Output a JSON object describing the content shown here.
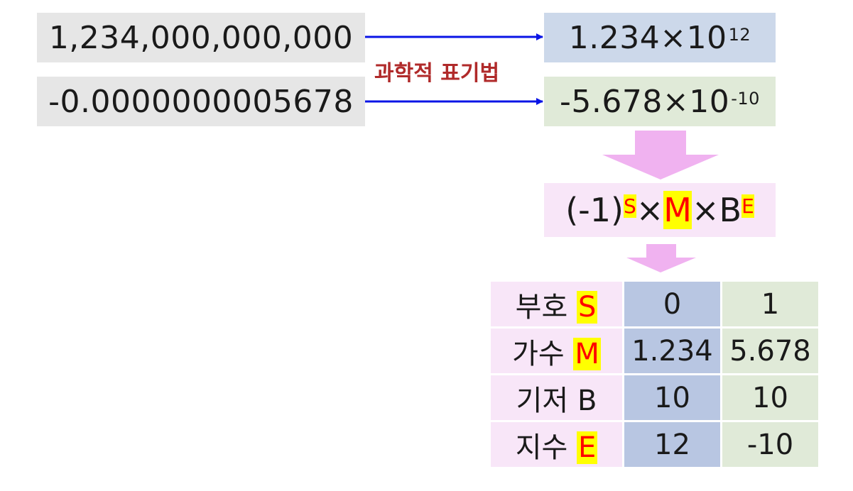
{
  "left_values": {
    "large": "1,234,000,000,000",
    "small": "-0.0000000005678"
  },
  "method_label": "과학적 표기법",
  "scientific": {
    "large": {
      "mantissa": "1.234",
      "times": "×",
      "base": "10",
      "exponent": "12"
    },
    "small": {
      "mantissa": "-5.678",
      "times": "×",
      "base": "10",
      "exponent": "-10"
    }
  },
  "formula": {
    "sign_part": "(-1)",
    "s": "S",
    "times1": "×",
    "m": "M",
    "times2": "×",
    "b": "B",
    "e": "E"
  },
  "table": {
    "rows": [
      {
        "label": "부호",
        "symbol": "S",
        "highlight": true,
        "v1": "0",
        "v2": "1"
      },
      {
        "label": "가수",
        "symbol": "M",
        "highlight": true,
        "v1": "1.234",
        "v2": "5.678"
      },
      {
        "label": "기저",
        "symbol": "B",
        "highlight": false,
        "v1": "10",
        "v2": "10"
      },
      {
        "label": "지수",
        "symbol": "E",
        "highlight": true,
        "v1": "12",
        "v2": "-10"
      }
    ]
  },
  "colors": {
    "arrow_blue": "#0a14e6",
    "down_arrow_pink": "#f0b2f0",
    "label_red": "#b02a2a",
    "highlight_yellow": "#ffff00",
    "highlight_red": "#ff0000"
  }
}
